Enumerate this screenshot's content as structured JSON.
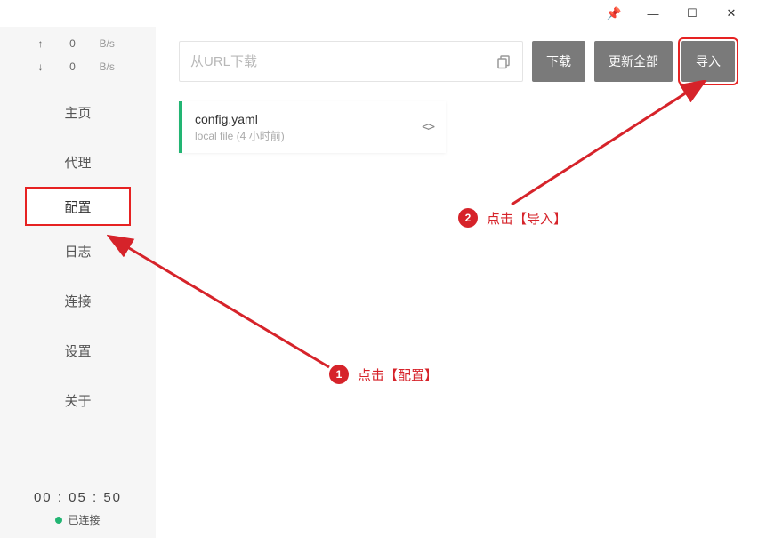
{
  "window": {
    "pin": "📌",
    "min": "—",
    "max": "☐",
    "close": "✕"
  },
  "speed": {
    "up_arrow": "↑",
    "up_val": "0",
    "up_unit": "B/s",
    "down_arrow": "↓",
    "down_val": "0",
    "down_unit": "B/s"
  },
  "nav": {
    "home": "主页",
    "proxy": "代理",
    "config": "配置",
    "log": "日志",
    "connections": "连接",
    "settings": "设置",
    "about": "关于"
  },
  "status": {
    "clock": "00 : 05 : 50",
    "connected": "已连接"
  },
  "toolbar": {
    "url_placeholder": "从URL下载",
    "download": "下载",
    "update_all": "更新全部",
    "import": "导入"
  },
  "card": {
    "title": "config.yaml",
    "sub": "local file (4 小时前)",
    "code": "<>"
  },
  "annotations": {
    "step1_num": "1",
    "step1_text": "点击【配置】",
    "step2_num": "2",
    "step2_text": "点击【导入】"
  }
}
